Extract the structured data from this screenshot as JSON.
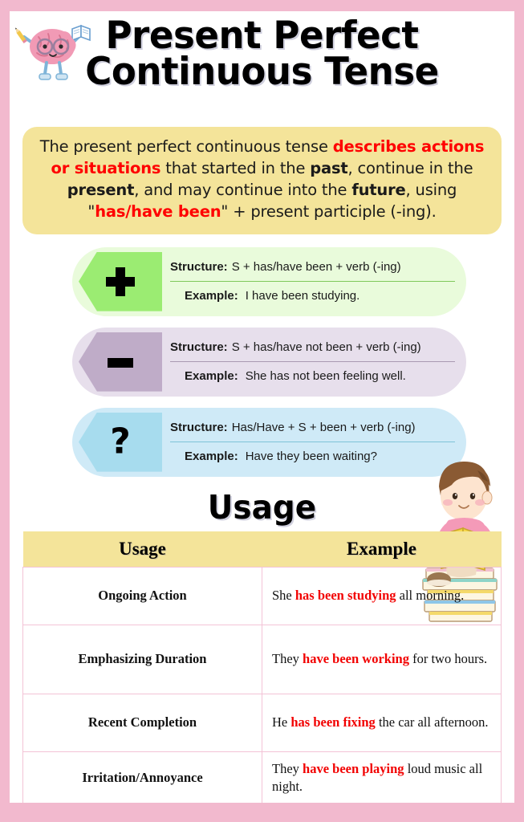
{
  "title": {
    "line1": "Present Perfect",
    "line2": "Continuous Tense"
  },
  "icons": {
    "brain": "brain-character-icon",
    "boy": "boy-reading-icon",
    "plus": "plus-icon",
    "minus": "minus-icon",
    "question": "question-mark-icon"
  },
  "definition": {
    "p1": "The present perfect continuous tense ",
    "red1": "describes actions or situations",
    "p2": " that started in the ",
    "b1": "past",
    "p3": ", continue in the ",
    "b2": "present",
    "p4": ", and may continue into the ",
    "b3": "future",
    "p5": ", using \"",
    "red2": "has/have been",
    "p6": "\" + present participle (-ing)."
  },
  "cards": [
    {
      "type": "positive",
      "symbol": "+",
      "structure_label": "Structure:",
      "structure_value": "S + has/have been + verb (-ing)",
      "example_label": "Example:",
      "example_value": "I have been studying.",
      "hex_color": "#9bec72",
      "bg_color": "#e9fbdb"
    },
    {
      "type": "negative",
      "symbol": "−",
      "structure_label": "Structure:",
      "structure_value": "S + has/have not been + verb (-ing)",
      "example_label": "Example:",
      "example_value": "She has not been feeling well.",
      "hex_color": "#bfacc8",
      "bg_color": "#e7dfec"
    },
    {
      "type": "question",
      "symbol": "?",
      "structure_label": "Structure:",
      "structure_value": "Has/Have + S + been + verb (-ing)",
      "example_label": "Example:",
      "example_value": "Have they been waiting?",
      "hex_color": "#a7dcee",
      "bg_color": "#cfeaf7"
    }
  ],
  "usage_section": {
    "heading": "Usage",
    "columns": [
      "Usage",
      "Example"
    ],
    "rows": [
      {
        "usage": "Ongoing Action",
        "example_pre": "She ",
        "example_bold": "has been studying",
        "example_post": " all morning."
      },
      {
        "usage": "Emphasizing Duration",
        "example_pre": "They ",
        "example_bold": "have been working",
        "example_post": " for two hours."
      },
      {
        "usage": "Recent Completion",
        "example_pre": "He ",
        "example_bold": "has been fixing",
        "example_post": " the car all afternoon."
      },
      {
        "usage": "Irritation/Annoyance",
        "example_pre": "They ",
        "example_bold": "have been playing",
        "example_post": " loud music all night."
      }
    ]
  },
  "colors": {
    "frame_pink": "#f2b9ce",
    "definition_yellow": "#f4e49a",
    "table_header_yellow": "#f4e49a",
    "table_border_pink": "#f3c3d6",
    "accent_red": "#ff0000",
    "example_red": "#f20000"
  }
}
